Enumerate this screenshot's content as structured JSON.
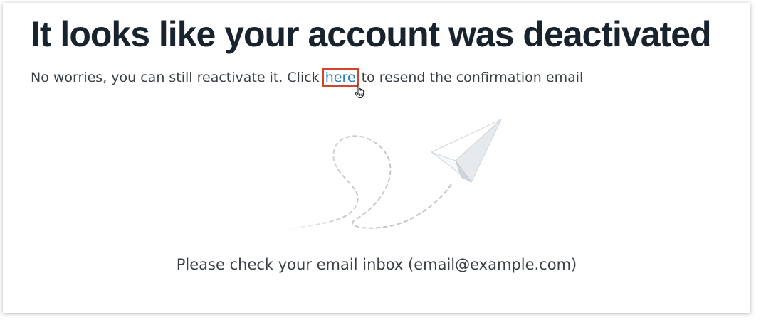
{
  "heading": "It looks like your account was deactivated",
  "message": {
    "before": "No worries, you can still reactivate it. Click ",
    "link_label": "here",
    "after": " to resend the confirmation email"
  },
  "inbox_note": "Please check your email inbox (email@example.com)",
  "icons": {
    "illustration": "paper-plane-icon",
    "cursor": "hand-pointer-icon"
  },
  "colors": {
    "heading": "#19232e",
    "text": "#3a4047",
    "link": "#2a7fc4",
    "highlight_box": "#d1452d"
  }
}
